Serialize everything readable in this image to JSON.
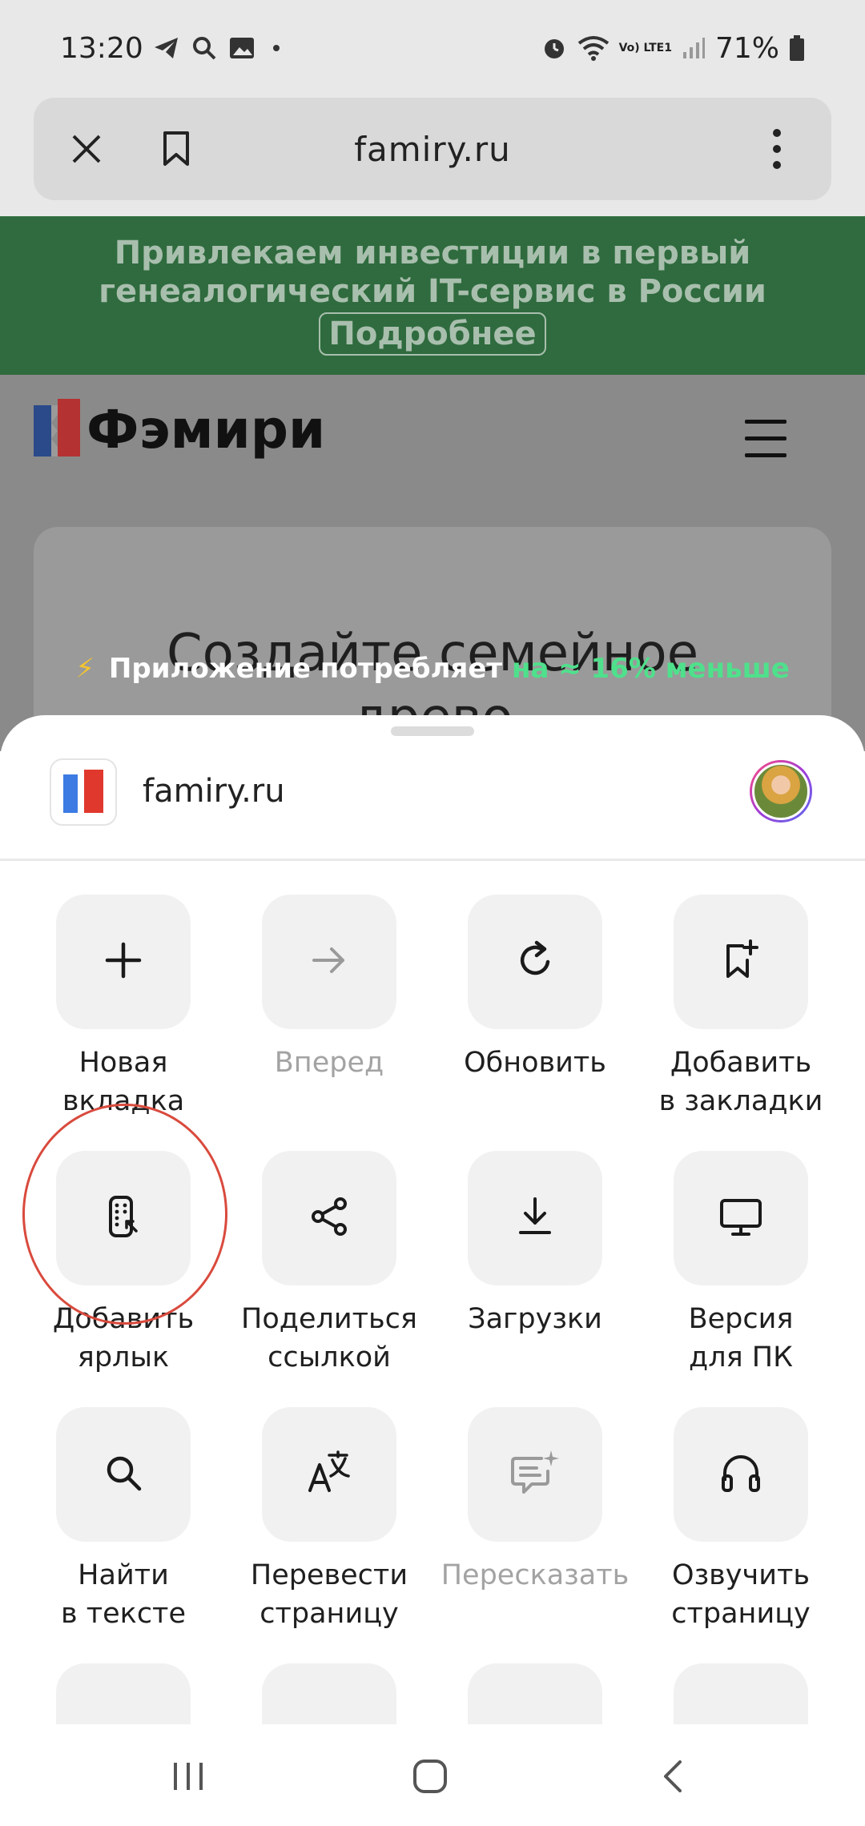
{
  "status_bar": {
    "time": "13:20",
    "battery": "71%",
    "lte_label": "Vo) LTE1"
  },
  "browser": {
    "url": "famiry.ru"
  },
  "page": {
    "promo_line1": "Привлекаем инвестиции в первый",
    "promo_line2": "генеалогический IT-сервис в России",
    "promo_button": "Подробнее",
    "site_name": "Фэмири",
    "hero_title_line1": "Создайте семейное",
    "hero_title_line2": "древо"
  },
  "toast": {
    "text": "Приложение потребляет",
    "accent": "на ≈ 16% меньше"
  },
  "sheet": {
    "site": "famiry.ru",
    "actions": [
      {
        "line1": "Новая",
        "line2": "вкладка",
        "icon": "plus-icon",
        "disabled": false
      },
      {
        "line1": "Вперед",
        "line2": "",
        "icon": "arrow-right-icon",
        "disabled": true
      },
      {
        "line1": "Обновить",
        "line2": "",
        "icon": "refresh-icon",
        "disabled": false
      },
      {
        "line1": "Добавить",
        "line2": "в закладки",
        "icon": "bookmark-add-icon",
        "disabled": false
      },
      {
        "line1": "Добавить",
        "line2": "ярлык",
        "icon": "shortcut-icon",
        "disabled": false
      },
      {
        "line1": "Поделиться",
        "line2": "ссылкой",
        "icon": "share-icon",
        "disabled": false
      },
      {
        "line1": "Загрузки",
        "line2": "",
        "icon": "download-icon",
        "disabled": false
      },
      {
        "line1": "Версия",
        "line2": "для ПК",
        "icon": "desktop-icon",
        "disabled": false
      },
      {
        "line1": "Найти",
        "line2": "в тексте",
        "icon": "search-icon",
        "disabled": false
      },
      {
        "line1": "Перевести",
        "line2": "страницу",
        "icon": "translate-icon",
        "disabled": false
      },
      {
        "line1": "Пересказать",
        "line2": "",
        "icon": "summary-icon",
        "disabled": true
      },
      {
        "line1": "Озвучить",
        "line2": "страницу",
        "icon": "headphones-icon",
        "disabled": false
      }
    ]
  },
  "colors": {
    "accent_green": "#4fe08b",
    "promo_bg": "#2f6b3e",
    "highlight": "#d94a3d"
  }
}
